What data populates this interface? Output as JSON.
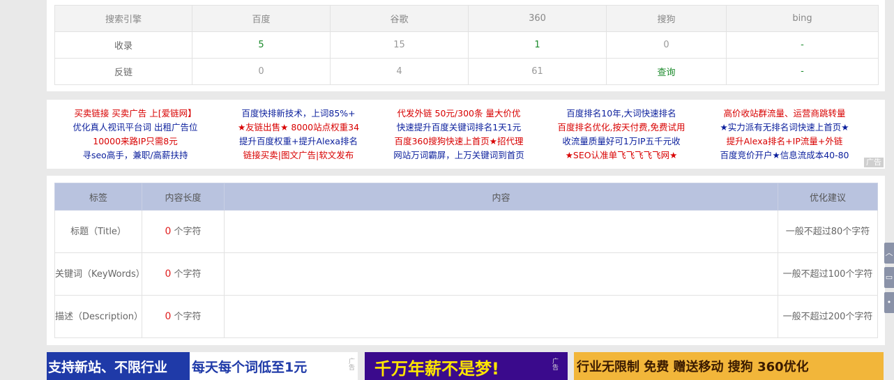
{
  "stats": {
    "headers": [
      "搜索引擎",
      "百度",
      "谷歌",
      "360",
      "搜狗",
      "bing"
    ],
    "rows": [
      {
        "label": "收录",
        "values": [
          "5",
          "15",
          "1",
          "0",
          "-"
        ]
      },
      {
        "label": "反链",
        "values": [
          "0",
          "4",
          "61",
          "查询",
          "-"
        ]
      }
    ]
  },
  "ads": {
    "columns": [
      [
        "买卖链接 买卖广告 上[爱链网】",
        "优化真人视讯平台词 出租广告位",
        "10000来路IP只需8元",
        "寻seo高手，兼职/高薪扶持"
      ],
      [
        "百度快排新技术，上词85%+",
        "★友链出售★ 8000站点权重34",
        "提升百度权重+提升Alexa排名",
        "链接买卖|图文广告|软文发布"
      ],
      [
        "代发外链 50元/300条 量大价优",
        "快速提升百度关键词排名1天1元",
        "百度360搜狗快速上首页★招代理",
        "网站万词霸屏，上万关键词到首页"
      ],
      [
        "百度排名10年,大词快速排名",
        "百度排名优化,按天付费,免费试用",
        "收流量质量好可1万IP五千元收",
        "★SEO认准单飞飞飞飞飞网★"
      ],
      [
        "高价收站群流量、运营商跳转量",
        "★实力派有无排名词快速上首页★",
        "提升Alexa排名+IP流量+外链",
        "百度竞价开户★信息流成本40-80"
      ]
    ],
    "tag": "广告"
  },
  "seo": {
    "headers": [
      "标签",
      "内容长度",
      "内容",
      "优化建议"
    ],
    "rows": [
      {
        "tag": "标题（Title）",
        "length": "0",
        "unit": "个字符",
        "content": "",
        "advice": "一般不超过80个字符"
      },
      {
        "tag": "关键词（KeyWords）",
        "length": "0",
        "unit": "个字符",
        "content": "",
        "advice": "一般不超过100个字符"
      },
      {
        "tag": "描述（Description）",
        "length": "0",
        "unit": "个字符",
        "content": "",
        "advice": "一般不超过200个字符"
      }
    ]
  },
  "banners": {
    "b1_left": "支持新站、不限行业",
    "b1_right": "每天每个词低至1元",
    "b1_tag": "广告",
    "b2": "千万年薪不是梦!",
    "b2_tag": "广告",
    "b3": "行业无限制 免费 赠送移动 搜狗 360优化"
  },
  "colors": {
    "green": "#1b8a2b",
    "red": "#d80000",
    "blue": "#0a1e9c",
    "header_blue": "#b9c3df"
  },
  "side_icons": [
    "up-arrow-icon",
    "feedback-icon",
    "more-icon"
  ]
}
